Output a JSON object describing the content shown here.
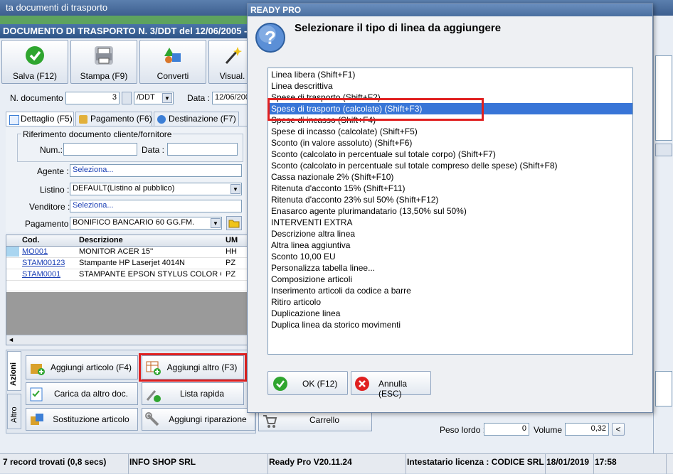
{
  "main": {
    "window_title": "ta documenti di trasporto",
    "doc_title": "DOCUMENTO DI TRASPORTO N. 3/DDT del 12/06/2005 -",
    "toolbar": [
      {
        "label": "Salva (F12)",
        "icon": "check-icon",
        "color": "#2fa52f"
      },
      {
        "label": "Stampa (F9)",
        "icon": "printer-icon",
        "color": "#8a8f99"
      },
      {
        "label": "Converti",
        "icon": "shapes-icon",
        "color": "#d9762b"
      },
      {
        "label": "Visual.",
        "icon": "wand-icon",
        "color": "#6b6b6b"
      }
    ],
    "doc_number_label": "N. documento :",
    "doc_number_value": "3",
    "doc_series": "/DDT",
    "date_label": "Data :",
    "date_value": "12/06/200",
    "tabs": [
      "Dettaglio (F5)",
      "Pagamento (F6)",
      "Destinazione (F7)"
    ],
    "ref_group_title": "Riferimento documento cliente/fornitore",
    "num_label": "Num.:",
    "data_label": "Data :",
    "agente_label": "Agente :",
    "agente_value": "Seleziona...",
    "listino_label": "Listino :",
    "listino_value": "DEFAULT(Listino al pubblico)",
    "venditore_label": "Venditore :",
    "venditore_value": "Seleziona...",
    "pagamento_label": "Pagamento :",
    "pagamento_value": "BONIFICO BANCARIO 60 GG.FM.",
    "grid_headers": [
      "Cod.",
      "Descrizione",
      "UM"
    ],
    "grid_rows": [
      {
        "cod": "MO001",
        "desc": "MONITOR ACER 15''",
        "um": "HH"
      },
      {
        "cod": "STAM00123",
        "desc": "Stampante HP Laserjet 4014N",
        "um": "PZ"
      },
      {
        "cod": "STAM0001",
        "desc": "STAMPANTE EPSON STYLUS COLOR C...",
        "um": "PZ"
      }
    ],
    "side_tabs": [
      "Azioni",
      "Altro"
    ],
    "actions": [
      "Aggiungi articolo (F4)",
      "Aggiungi altro (F3)",
      "Carica da altro doc.",
      "Lista rapida",
      "Sostituzione articolo",
      "Aggiungi riparazione",
      "Carrello"
    ],
    "peso_label": "Peso lordo :",
    "peso_value": "0",
    "volume_label": "Volume :",
    "volume_value": "0,32",
    "volume_btn": "<"
  },
  "status": {
    "records": "7 record trovati (0,8 secs)",
    "company": "INFO SHOP SRL",
    "version": "Ready Pro V20.11.24",
    "license": "Intestatario licenza : CODICE SRL",
    "date": "18/01/2019",
    "time": "17:58"
  },
  "dialog": {
    "title": "READY PRO",
    "question": "Selezionare il tipo di linea da aggiungere",
    "selected_index": 3,
    "items": [
      "Linea libera (Shift+F1)",
      "Linea descrittiva",
      "Spese di trasporto (Shift+F2)",
      "Spese di trasporto (calcolate) (Shift+F3)",
      "Spese di incasso (Shift+F4)",
      "Spese di incasso (calcolate) (Shift+F5)",
      "Sconto (in valore assoluto) (Shift+F6)",
      "Sconto (calcolato in percentuale sul totale corpo) (Shift+F7)",
      "Sconto (calcolato in percentuale sul totale compreso delle spese) (Shift+F8)",
      "Cassa nazionale 2% (Shift+F10)",
      "Ritenuta d'acconto 15% (Shift+F11)",
      "Ritenuta d'acconto 23% sul 50% (Shift+F12)",
      "Enasarco agente plurimandatario (13,50% sul 50%)",
      "INTERVENTI EXTRA",
      "Descrizione altra linea",
      "Altra linea aggiuntiva",
      "Sconto 10,00 EU",
      "Personalizza tabella linee...",
      "Composizione articoli",
      "Inserimento articoli da codice a barre",
      "Ritiro articolo",
      "Duplicazione linea",
      "Duplica linea da storico movimenti"
    ],
    "ok_label": "OK (F12)",
    "cancel_label": "Annulla (ESC)"
  }
}
